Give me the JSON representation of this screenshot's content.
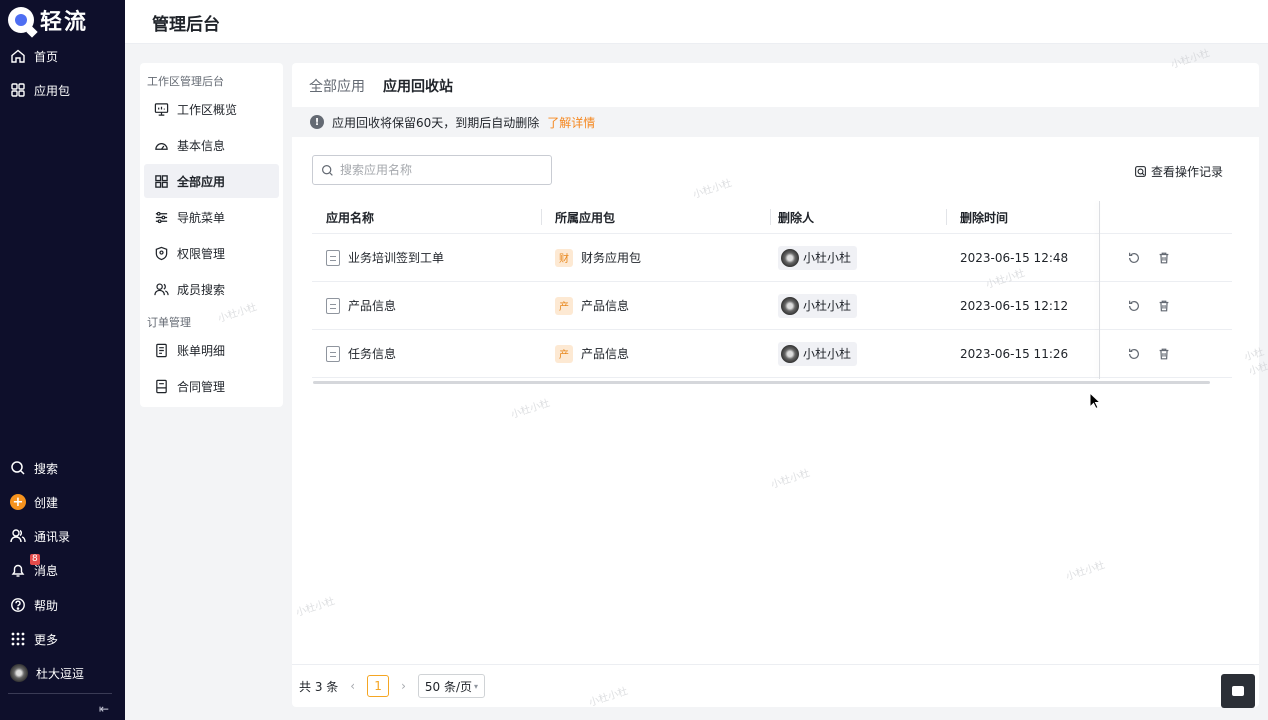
{
  "brand": {
    "name": "轻流"
  },
  "leftnav": {
    "top_items": [
      {
        "label": "首页",
        "icon": "home-icon"
      },
      {
        "label": "应用包",
        "icon": "grid-icon"
      }
    ],
    "bottom_items": [
      {
        "label": "搜索",
        "icon": "search-icon"
      },
      {
        "label": "创建",
        "icon": "plus-icon"
      },
      {
        "label": "通讯录",
        "icon": "contacts-icon"
      },
      {
        "label": "消息",
        "icon": "bell-icon",
        "badge": "8"
      },
      {
        "label": "帮助",
        "icon": "help-icon"
      },
      {
        "label": "更多",
        "icon": "more-grid-icon"
      },
      {
        "label": "杜大逗逗",
        "icon": "avatar"
      }
    ],
    "collapse_glyph": "⇤"
  },
  "header": {
    "title": "管理后台"
  },
  "subnav": {
    "group1": "工作区管理后台",
    "items1": [
      {
        "label": "工作区概览",
        "icon": "monitor-icon"
      },
      {
        "label": "基本信息",
        "icon": "gauge-icon"
      },
      {
        "label": "全部应用",
        "icon": "apps-icon",
        "active": true
      },
      {
        "label": "导航菜单",
        "icon": "sliders-icon"
      },
      {
        "label": "权限管理",
        "icon": "shield-icon"
      },
      {
        "label": "成员搜索",
        "icon": "members-icon"
      }
    ],
    "group2": "订单管理",
    "items2": [
      {
        "label": "账单明细",
        "icon": "bill-icon"
      },
      {
        "label": "合同管理",
        "icon": "contract-icon"
      }
    ]
  },
  "tabs": {
    "all": "全部应用",
    "recycle": "应用回收站"
  },
  "notice": {
    "text": "应用回收将保留60天，到期后自动删除",
    "link": "了解详情"
  },
  "search": {
    "placeholder": "搜索应用名称"
  },
  "oplog": {
    "label": "查看操作记录"
  },
  "table": {
    "headers": {
      "name": "应用名称",
      "package": "所属应用包",
      "deleter": "删除人",
      "time": "删除时间"
    },
    "rows": [
      {
        "name": "业务培训签到工单",
        "pkg_tag": "财",
        "package": "财务应用包",
        "deleter": "小杜小杜",
        "time": "2023-06-15 12:48"
      },
      {
        "name": "产品信息",
        "pkg_tag": "产",
        "package": "产品信息",
        "deleter": "小杜小杜",
        "time": "2023-06-15 12:12"
      },
      {
        "name": "任务信息",
        "pkg_tag": "产",
        "package": "产品信息",
        "deleter": "小杜小杜",
        "time": "2023-06-15 11:26"
      }
    ]
  },
  "pagination": {
    "total": "共 3 条",
    "prev": "‹",
    "page": "1",
    "next": "›",
    "page_size": "50 条/页"
  },
  "watermark": "小杜小杜",
  "colors": {
    "accent": "#f5a623",
    "nav_bg": "#0e0f2b",
    "link": "#f5871f"
  }
}
